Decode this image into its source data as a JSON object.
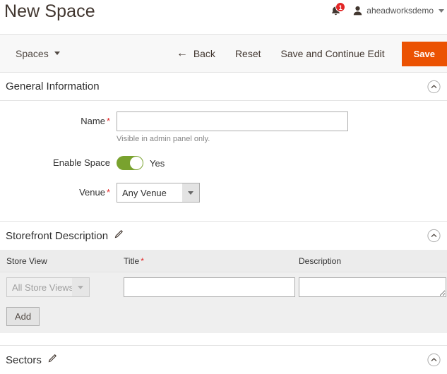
{
  "header": {
    "title": "New Space",
    "notifications": {
      "icon": "bell-icon",
      "count": "1"
    },
    "user": {
      "icon": "user-icon",
      "name": "aheadworksdemo"
    }
  },
  "toolbar": {
    "switcher_label": "Spaces",
    "back_label": "Back",
    "back_icon": "arrow-left-icon",
    "reset_label": "Reset",
    "save_continue_label": "Save and Continue Edit",
    "save_label": "Save",
    "primary_color": "#eb5202"
  },
  "sections": {
    "general": {
      "title": "General Information",
      "collapse_icon": "chevron-up-circle-icon",
      "fields": {
        "name": {
          "label": "Name",
          "required": "*",
          "value": "",
          "placeholder": "",
          "note": "Visible in admin panel only."
        },
        "enable_space": {
          "label": "Enable Space",
          "state_label": "Yes",
          "on": true,
          "on_color": "#79a22e"
        },
        "venue": {
          "label": "Venue",
          "required": "*",
          "selected": "Any Venue",
          "options": [
            "Any Venue"
          ]
        }
      }
    },
    "storefront": {
      "title": "Storefront Description",
      "edit_icon": "pencil-icon",
      "collapse_icon": "chevron-up-circle-icon",
      "columns": [
        {
          "label": "Store View",
          "required": ""
        },
        {
          "label": "Title",
          "required": "*"
        },
        {
          "label": "Description",
          "required": ""
        }
      ],
      "rows": [
        {
          "store_view": "All Store Views",
          "store_view_disabled": true,
          "title": "",
          "description": ""
        }
      ],
      "add_label": "Add"
    },
    "sectors": {
      "title": "Sectors",
      "edit_icon": "pencil-icon",
      "collapse_icon": "chevron-up-circle-icon"
    }
  }
}
